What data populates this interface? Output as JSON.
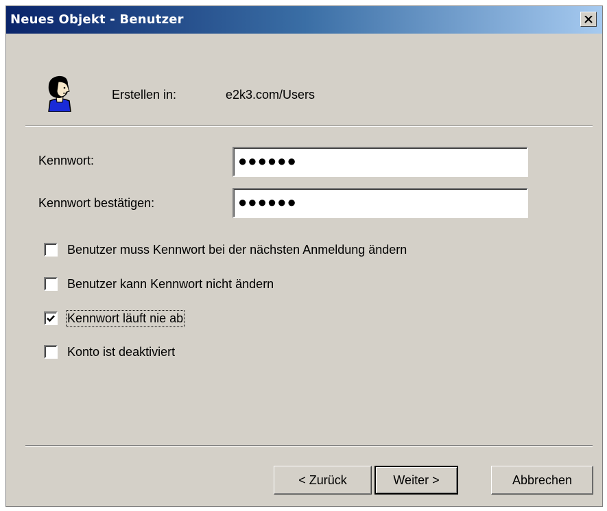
{
  "window": {
    "title": "Neues Objekt - Benutzer",
    "close_glyph": "✕"
  },
  "header": {
    "icon": "user-icon",
    "create_label": "Erstellen in:",
    "create_value": "e2k3.com/Users"
  },
  "form": {
    "password_label": "Kennwort:",
    "password_value": "●●●●●●",
    "confirm_label": "Kennwort bestätigen:",
    "confirm_value": "●●●●●●"
  },
  "options": [
    {
      "label": "Benutzer muss Kennwort bei der nächsten Anmeldung ändern",
      "checked": false
    },
    {
      "label": "Benutzer kann Kennwort nicht ändern",
      "checked": false
    },
    {
      "label": "Kennwort läuft nie ab",
      "checked": true
    },
    {
      "label": "Konto ist deaktiviert",
      "checked": false
    }
  ],
  "buttons": {
    "back": "< Zurück",
    "next": "Weiter >",
    "cancel": "Abbrechen"
  },
  "colors": {
    "title_start": "#0a246a",
    "title_end": "#a6caf0",
    "dialog_bg": "#d4d0c8"
  }
}
